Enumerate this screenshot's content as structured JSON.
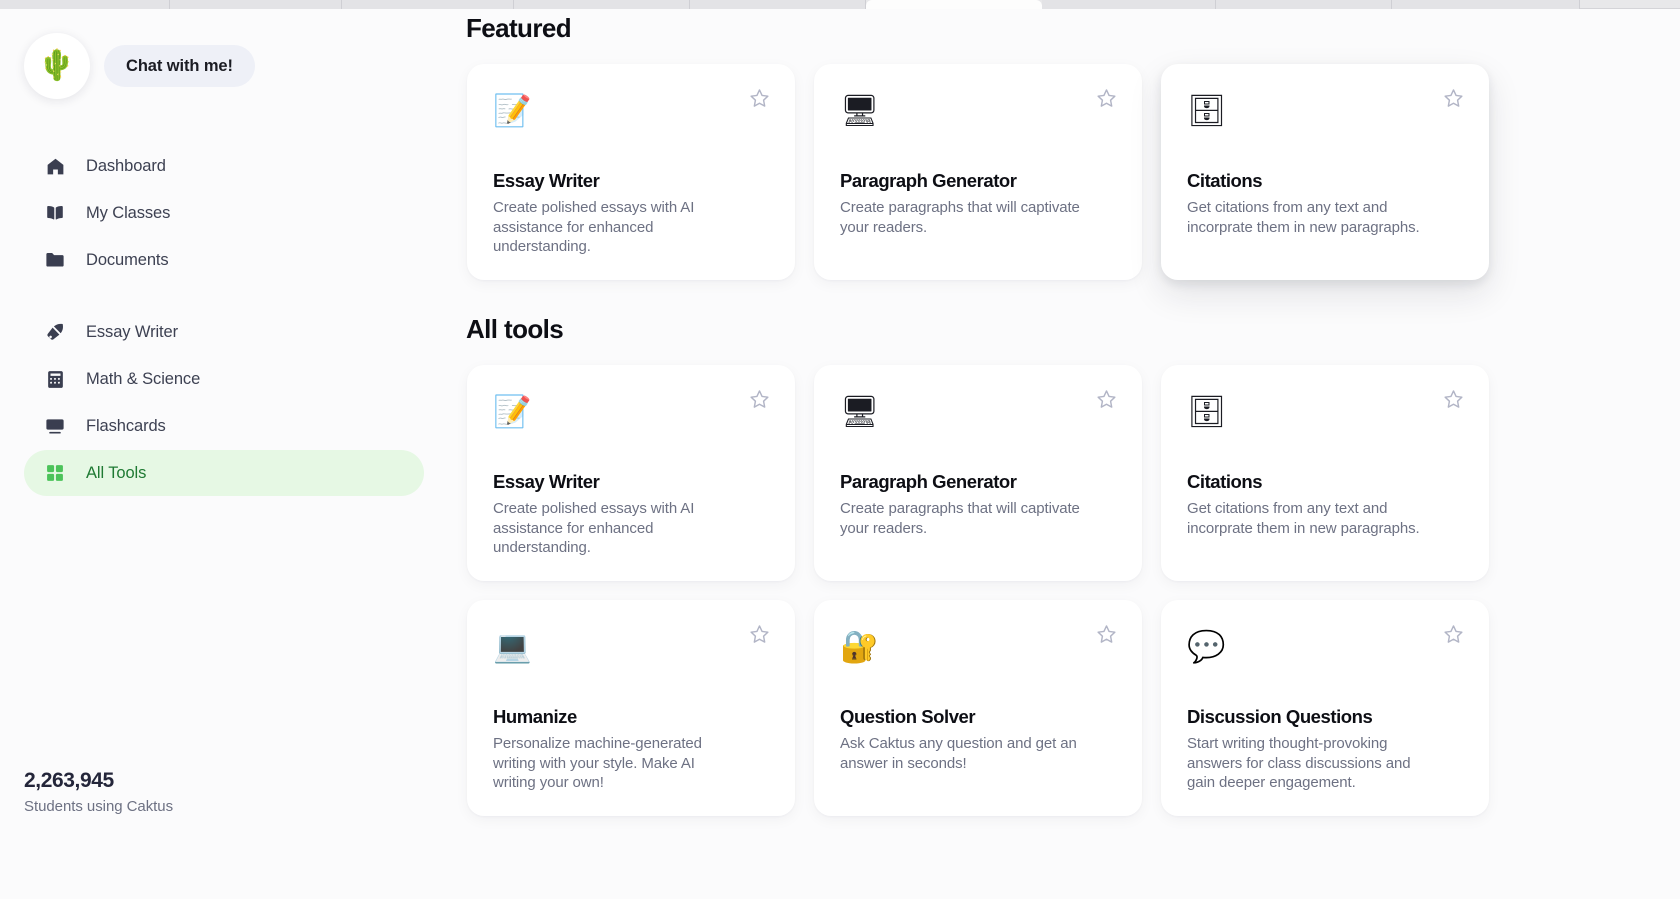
{
  "browser": {
    "tabs_visible": 9,
    "active_tab_index": 5
  },
  "sidebar": {
    "logo_icon": "cactus-icon",
    "logo_glyph": "🌵",
    "chat_button_label": "Chat with me!",
    "groups": [
      {
        "items": [
          {
            "label": "Dashboard",
            "icon": "home-icon",
            "active": false
          },
          {
            "label": "My Classes",
            "icon": "book-icon",
            "active": false
          },
          {
            "label": "Documents",
            "icon": "folder-icon",
            "active": false
          }
        ]
      },
      {
        "items": [
          {
            "label": "Essay Writer",
            "icon": "pen-nib-icon",
            "active": false
          },
          {
            "label": "Math & Science",
            "icon": "calculator-icon",
            "active": false
          },
          {
            "label": "Flashcards",
            "icon": "flashcard-icon",
            "active": false
          },
          {
            "label": "All Tools",
            "icon": "grid-icon",
            "active": true
          }
        ]
      }
    ],
    "stats": {
      "count": "2,263,945",
      "caption": "Students using Caktus"
    }
  },
  "main": {
    "featured": {
      "title": "Featured",
      "cards": [
        {
          "name": "Essay Writer",
          "description": "Create polished essays with AI assistance for enhanced understanding.",
          "icon": "document-pencil-icon",
          "emoji": "📝",
          "starred": false,
          "hover": false
        },
        {
          "name": "Paragraph Generator",
          "description": "Create paragraphs that will captivate your readers.",
          "icon": "monitor-document-pencil-icon",
          "emoji": "🖥",
          "starred": false,
          "hover": false
        },
        {
          "name": "Citations",
          "description": "Get citations from any text and incorprate them in new paragraphs.",
          "icon": "file-cabinet-icon",
          "emoji": "🗄",
          "starred": false,
          "hover": true
        }
      ]
    },
    "all_tools": {
      "title": "All tools",
      "cards": [
        {
          "name": "Essay Writer",
          "description": "Create polished essays with AI assistance for enhanced understanding.",
          "icon": "document-pencil-icon",
          "emoji": "📝",
          "starred": false,
          "hover": false
        },
        {
          "name": "Paragraph Generator",
          "description": "Create paragraphs that will captivate your readers.",
          "icon": "monitor-document-pencil-icon",
          "emoji": "🖥",
          "starred": false,
          "hover": false
        },
        {
          "name": "Citations",
          "description": "Get citations from any text and incorprate them in new paragraphs.",
          "icon": "file-cabinet-icon",
          "emoji": "🗄",
          "starred": false,
          "hover": false
        },
        {
          "name": "Humanize",
          "description": "Personalize machine-generated writing with your style. Make AI writing your own!",
          "icon": "laptop-brain-icon",
          "emoji": "💻",
          "starred": false,
          "hover": false
        },
        {
          "name": "Question Solver",
          "description": "Ask Caktus any question and get an answer in seconds!",
          "icon": "padlock-icon",
          "emoji": "🔐",
          "starred": false,
          "hover": false
        },
        {
          "name": "Discussion Questions",
          "description": "Start writing thought-provoking answers for class discussions and gain deeper engagement.",
          "icon": "speech-bubbles-icon",
          "emoji": "💬",
          "starred": false,
          "hover": false
        }
      ]
    }
  },
  "colors": {
    "page_background": "#fbfbfc",
    "card_background": "#ffffff",
    "active_nav_background": "#e6f8e4",
    "active_nav_text": "#1f7a33",
    "active_nav_icon": "#4cc35a",
    "heading_text": "#0d0e14",
    "muted_text": "#6d7183",
    "star_outline": "#b2b5c6",
    "chat_pill_background": "#eef0f7"
  }
}
